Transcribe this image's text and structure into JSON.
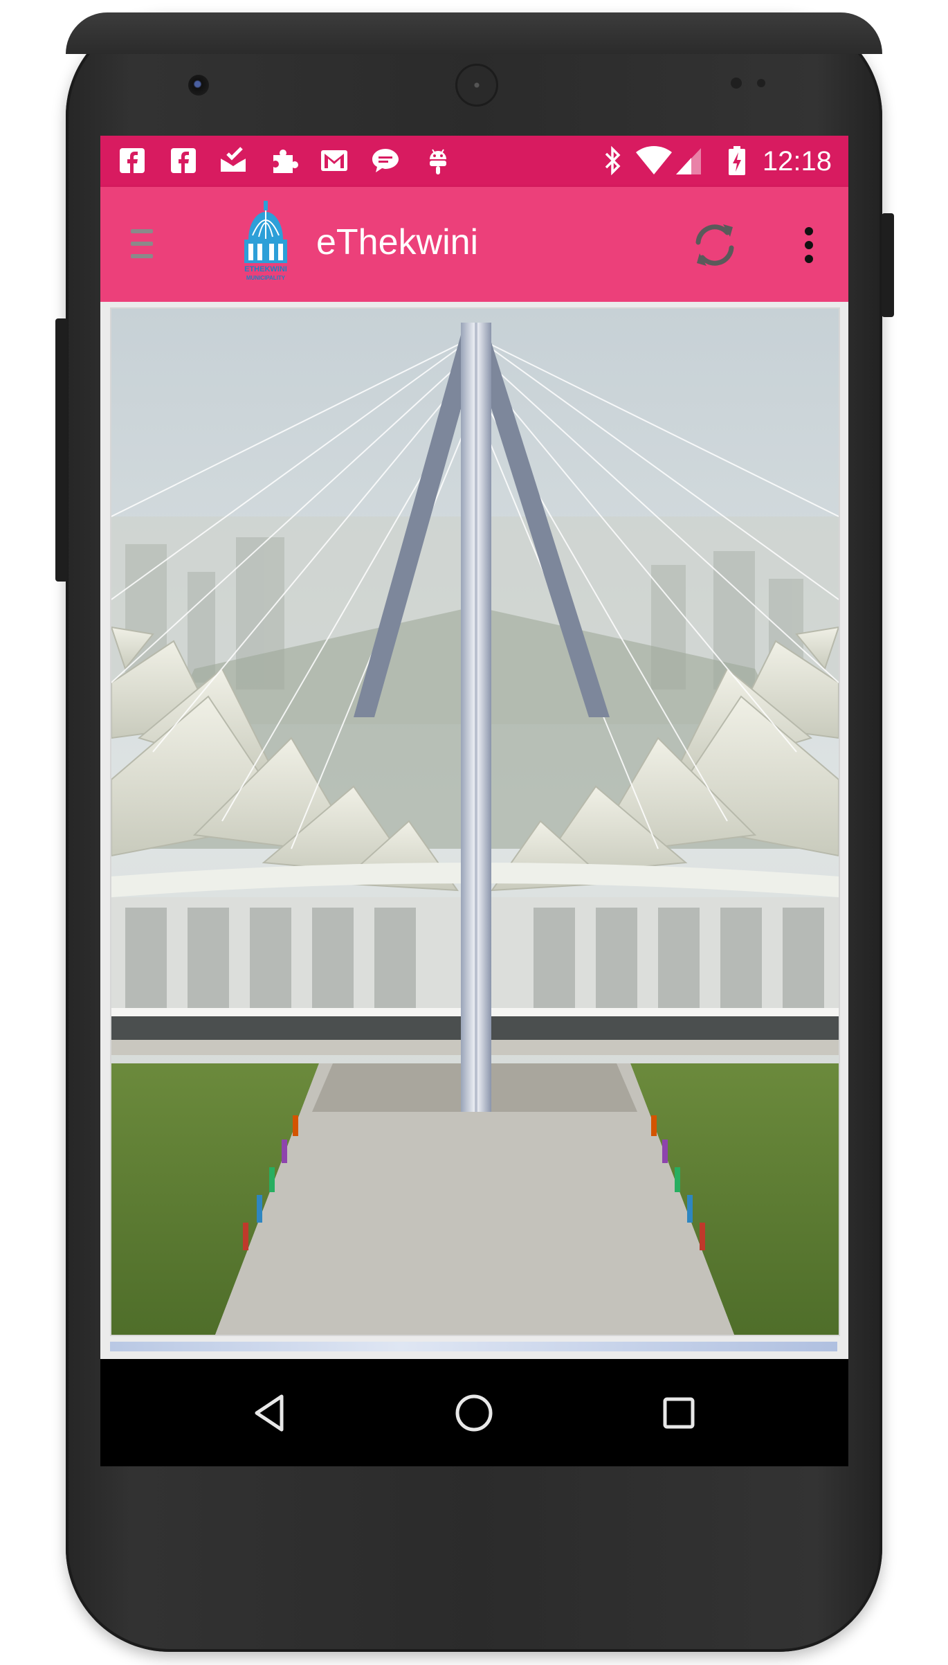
{
  "status_bar": {
    "time": "12:18",
    "background_color": "#d81b60",
    "notification_icons": [
      "facebook-icon",
      "facebook-icon",
      "inbox-check-icon",
      "puzzle-icon",
      "gmail-icon",
      "chat-bubble-icon",
      "android-icon"
    ],
    "system_icons": [
      "bluetooth-icon",
      "wifi-icon",
      "cell-signal-icon",
      "battery-charging-icon"
    ]
  },
  "app_bar": {
    "title": "eThekwini",
    "background_color": "#ec407a",
    "logo_text": "ETHEKWINI MUNICIPALITY",
    "actions": [
      "menu-icon",
      "sync-icon",
      "more-vert-icon"
    ]
  },
  "content": {
    "image_subject": "Moses Mabhida Stadium arch"
  },
  "nav_bar": {
    "buttons": [
      "back-icon",
      "home-icon",
      "recents-icon"
    ]
  }
}
